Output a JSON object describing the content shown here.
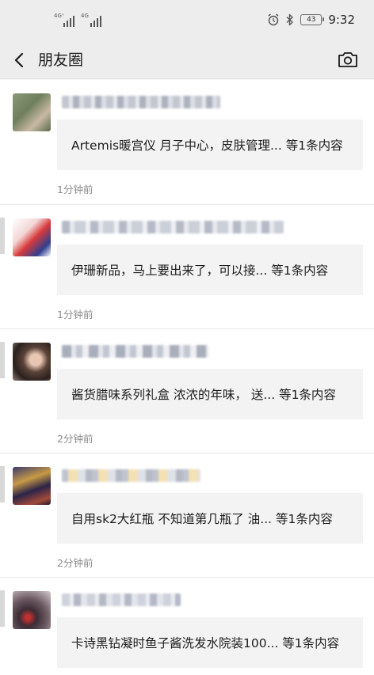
{
  "status_bar": {
    "network_labels": [
      "4G⁺",
      "4G"
    ],
    "battery": "43",
    "time": "9:32",
    "icons": [
      "alarm-icon",
      "bluetooth-icon",
      "battery-icon"
    ]
  },
  "nav": {
    "title": "朋友圈",
    "back_icon": "chevron-left-icon",
    "camera_icon": "camera-icon"
  },
  "feed": {
    "items": [
      {
        "text": "Artemis暖宫仪 月子中心，皮肤管理... 等1条内容",
        "time": "1分钟前"
      },
      {
        "text": "伊珊新品，马上要出来了，可以接... 等1条内容",
        "time": "1分钟前"
      },
      {
        "text": "酱货腊味系列礼盒 浓浓的年味， 送... 等1条内容",
        "time": "2分钟前"
      },
      {
        "text": "自用sk2大红瓶 不知道第几瓶了 油... 等1条内容",
        "time": "2分钟前"
      },
      {
        "text": "卡诗黑钻凝时鱼子酱洗发水院装100... 等1条内容",
        "time": ""
      }
    ]
  }
}
